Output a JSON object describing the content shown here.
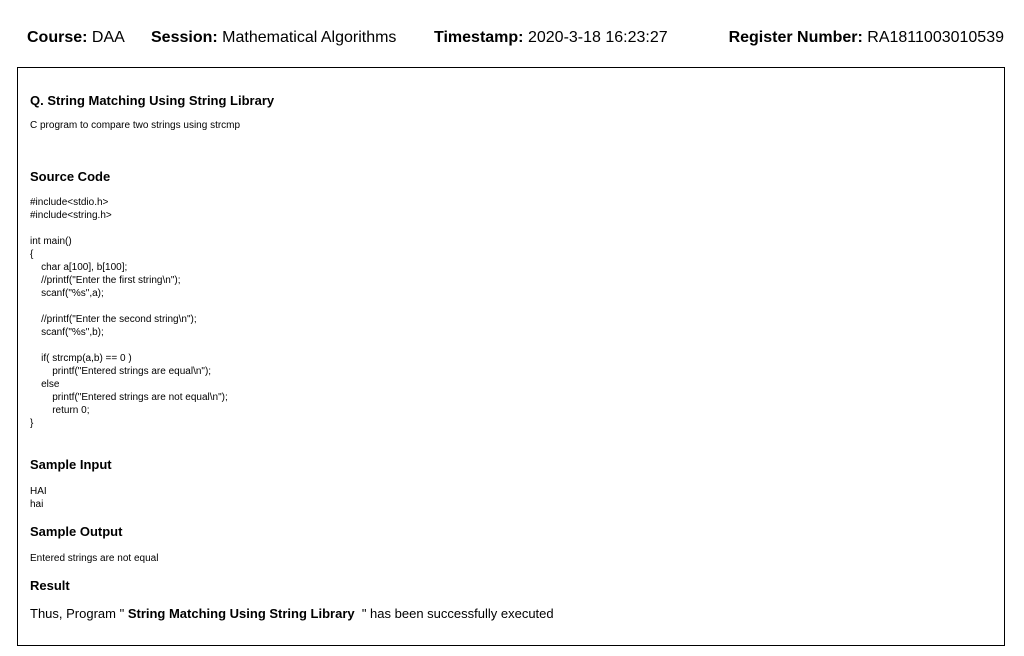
{
  "header": {
    "course_label": "Course:",
    "course_value": "DAA",
    "session_label": "Session:",
    "session_value": "Mathematical Algorithms",
    "timestamp_label": "Timestamp:",
    "timestamp_value": "2020-3-18 16:23:27",
    "register_label": "Register Number:",
    "register_value": "RA1811003010539"
  },
  "question": {
    "title": "Q. String Matching Using String Library",
    "description": "C program to compare two strings using strcmp"
  },
  "source_code": {
    "heading": "Source Code",
    "code": "#include<stdio.h>\n#include<string.h>\n\nint main()\n{\n    char a[100], b[100];\n    //printf(\"Enter the first string\\n\");\n    scanf(\"%s\",a);\n\n    //printf(\"Enter the second string\\n\");\n    scanf(\"%s\",b);\n\n    if( strcmp(a,b) == 0 )\n        printf(\"Entered strings are equal\\n\");\n    else\n        printf(\"Entered strings are not equal\\n\");\n        return 0;\n}"
  },
  "sample_input": {
    "heading": "Sample Input",
    "lines": [
      "HAI",
      "hai"
    ]
  },
  "sample_output": {
    "heading": "Sample Output",
    "text": "Entered strings are not equal"
  },
  "result": {
    "heading": "Result",
    "prefix": "Thus, Program \" ",
    "program_name": "String Matching Using String Library",
    "suffix": "  \" has been successfully executed"
  }
}
